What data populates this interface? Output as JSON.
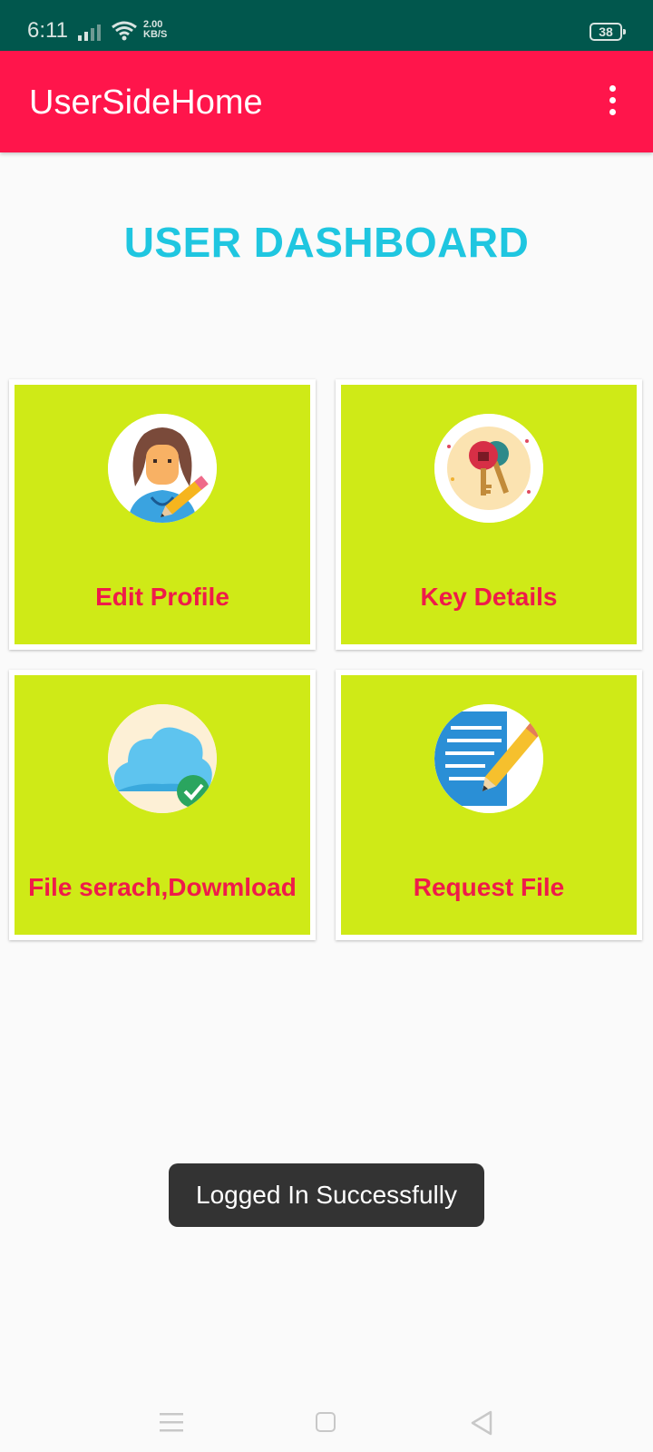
{
  "status_bar": {
    "time": "6:11",
    "net_speed_value": "2.00",
    "net_speed_unit": "KB/S",
    "battery": "38",
    "icons": [
      "signal-icon",
      "wifi-icon",
      "battery-icon"
    ]
  },
  "app_bar": {
    "title": "UserSideHome",
    "menu_icon": "more-vert-icon"
  },
  "dashboard": {
    "title": "USER DASHBOARD",
    "tiles": [
      {
        "label": "Edit Profile",
        "icon": "edit-profile-icon"
      },
      {
        "label": "Key Details",
        "icon": "key-icon"
      },
      {
        "label": "File serach,Dowmload",
        "icon": "cloud-check-icon"
      },
      {
        "label": "Request File",
        "icon": "document-pencil-icon"
      }
    ]
  },
  "toast": {
    "message": "Logged In Successfully"
  },
  "nav_bar": {
    "icons": [
      "menu-icon",
      "home-icon",
      "back-icon"
    ]
  },
  "colors": {
    "status_bar": "#01574d",
    "app_bar": "#ff154b",
    "dashboard_title": "#1fc6e0",
    "tile_background": "#cfea17",
    "tile_label": "#ef1b4a",
    "toast_background": "#333333"
  }
}
